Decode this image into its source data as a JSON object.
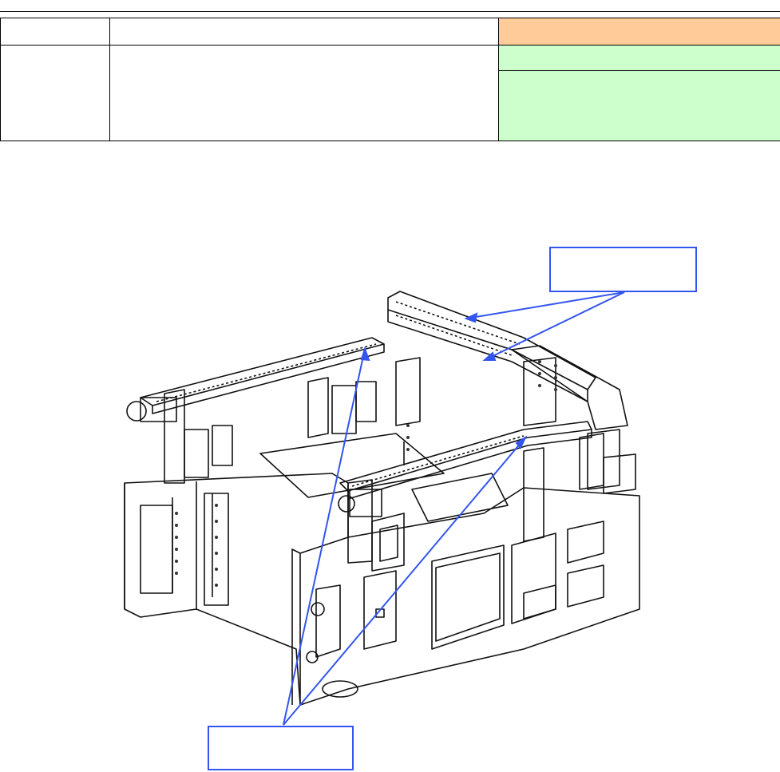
{
  "header_table": {
    "rows": [
      {
        "col1": "",
        "col2": "",
        "col3": ""
      },
      {
        "col1": "",
        "col2": "",
        "col3a": "",
        "col3b": ""
      }
    ]
  },
  "figure": {
    "callout_top": {
      "text": ""
    },
    "callout_bottom": {
      "text": ""
    }
  },
  "colors": {
    "orange_cell": "#ffcc99",
    "green_cell": "#ccffcc",
    "callout_border": "#3355ee"
  }
}
